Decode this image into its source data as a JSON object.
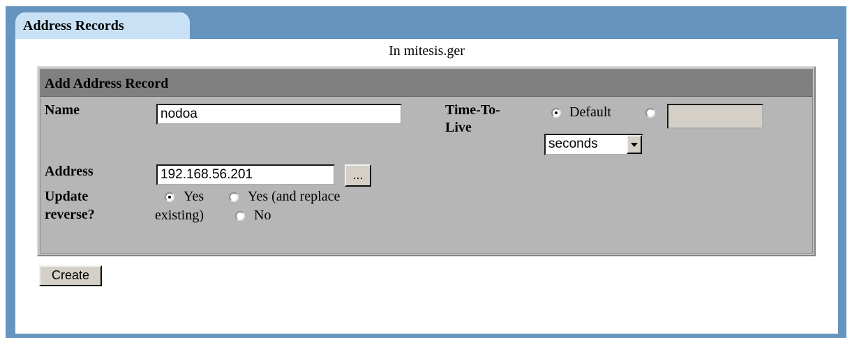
{
  "tab": {
    "label": "Address Records"
  },
  "subtitle": "In mitesis.ger",
  "form": {
    "heading": "Add Address Record",
    "name": {
      "label": "Name",
      "value": "nodoa"
    },
    "ttl": {
      "label_line1": "Time-To-",
      "label_line2": "Live",
      "default_option": "Default",
      "default_selected": true,
      "custom_value": "",
      "unit_selected": "seconds"
    },
    "address": {
      "label": "Address",
      "value": "192.168.56.201",
      "browse_label": "..."
    },
    "update_reverse": {
      "label_line1": "Update",
      "label_line2": "reverse?",
      "opt_yes": "Yes",
      "opt_replace_line1": "Yes (and replace",
      "opt_replace_line2": "existing)",
      "opt_no": "No",
      "selected": "Yes"
    },
    "create_button": "Create"
  }
}
